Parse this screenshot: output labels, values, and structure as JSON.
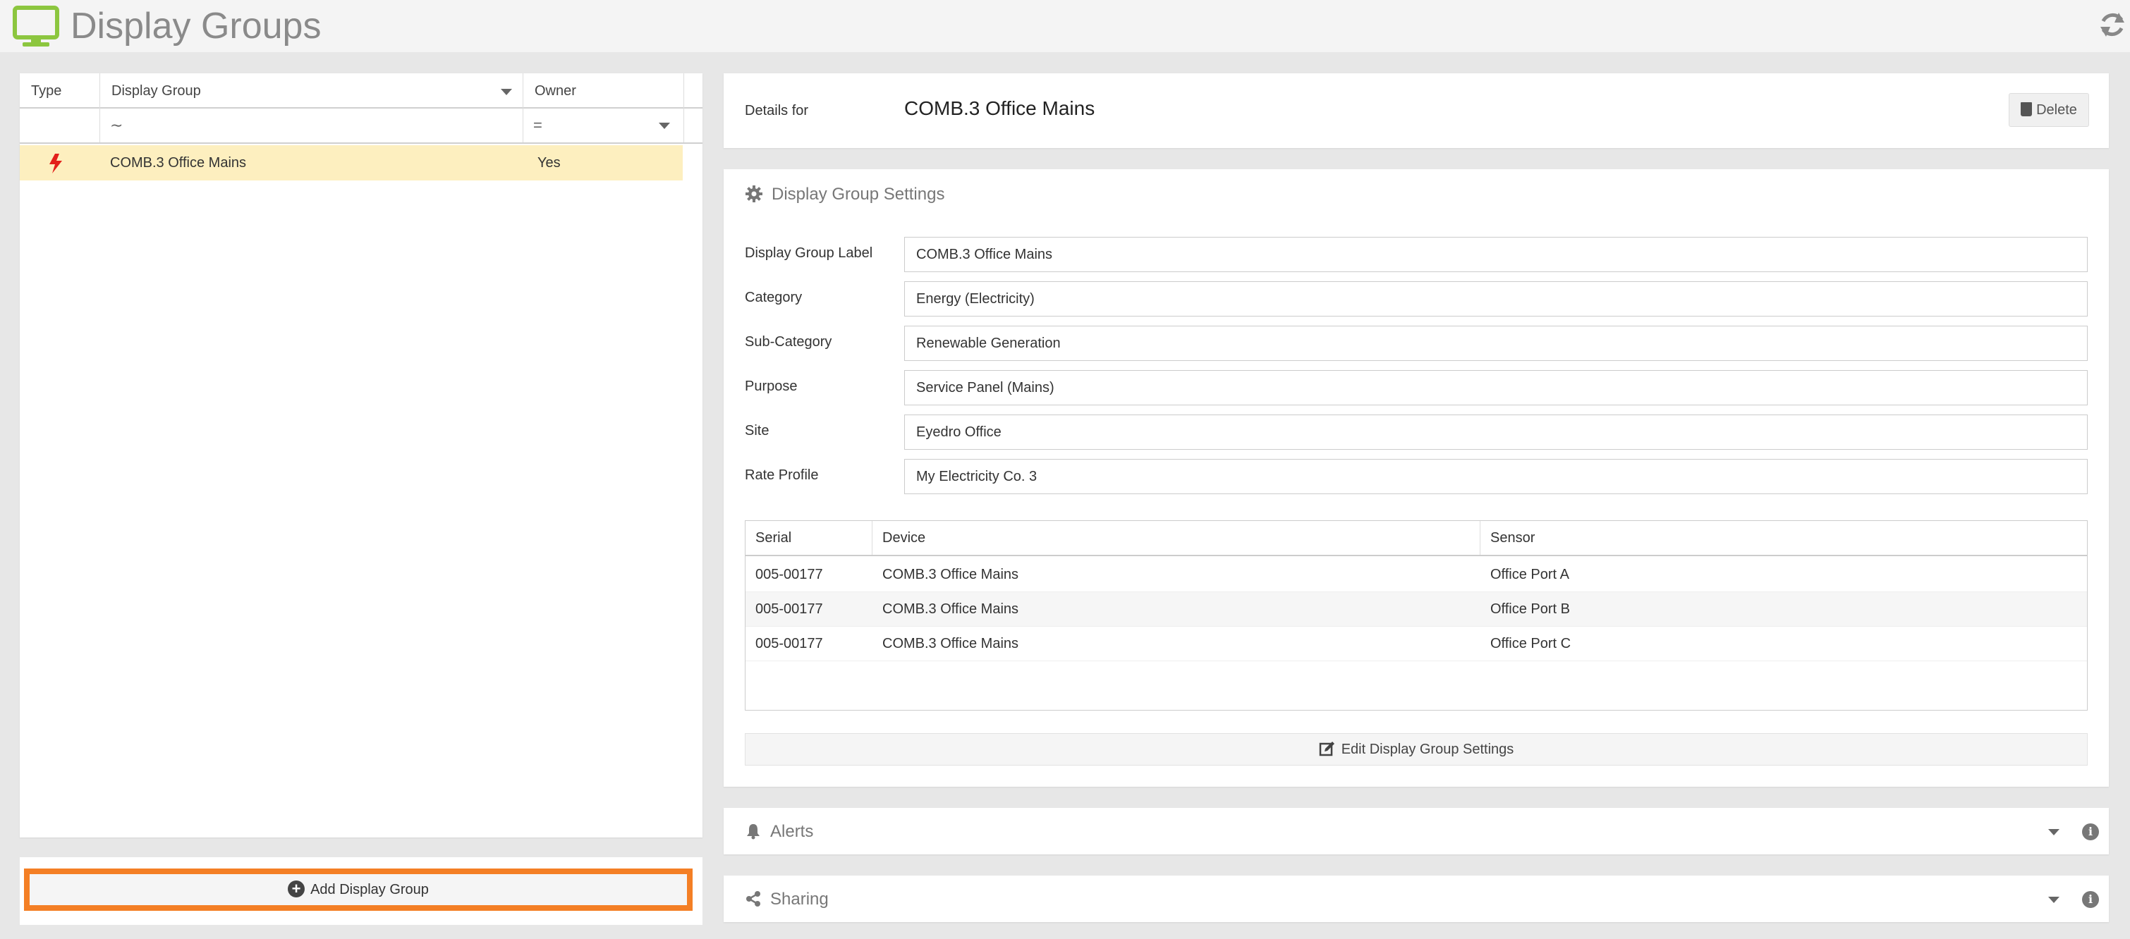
{
  "header": {
    "title": "Display Groups"
  },
  "grid": {
    "columns": {
      "type": "Type",
      "display_group": "Display Group",
      "owner": "Owner"
    },
    "filters": {
      "display_group": "∼",
      "owner": "="
    },
    "rows": [
      {
        "display_group": "COMB.3 Office Mains",
        "owner": "Yes"
      }
    ]
  },
  "add_button": {
    "label": "Add Display Group"
  },
  "details": {
    "label": "Details for",
    "name": "COMB.3 Office Mains",
    "delete_label": "Delete"
  },
  "settings": {
    "title": "Display Group Settings",
    "fields": [
      {
        "label": "Display Group Label",
        "value": "COMB.3 Office Mains"
      },
      {
        "label": "Category",
        "value": "Energy (Electricity)"
      },
      {
        "label": "Sub-Category",
        "value": "Renewable Generation"
      },
      {
        "label": "Purpose",
        "value": "Service Panel (Mains)"
      },
      {
        "label": "Site",
        "value": "Eyedro Office"
      },
      {
        "label": "Rate Profile",
        "value": "My Electricity Co. 3"
      }
    ],
    "devices": {
      "columns": {
        "serial": "Serial",
        "device": "Device",
        "sensor": "Sensor"
      },
      "rows": [
        {
          "serial": "005-00177",
          "device": "COMB.3 Office Mains",
          "sensor": "Office Port A"
        },
        {
          "serial": "005-00177",
          "device": "COMB.3 Office Mains",
          "sensor": "Office Port B"
        },
        {
          "serial": "005-00177",
          "device": "COMB.3 Office Mains",
          "sensor": "Office Port C"
        }
      ]
    },
    "edit_label": "Edit Display Group Settings"
  },
  "alerts": {
    "title": "Alerts"
  },
  "sharing": {
    "title": "Sharing"
  },
  "icons": {
    "app": "monitor-icon",
    "refresh": "refresh-icon",
    "type": "lightning-bolt-icon",
    "settings": "gear-icon",
    "alerts": "bell-icon",
    "sharing": "share-icon",
    "delete": "trash-icon",
    "edit": "edit-icon",
    "add": "plus-circle-icon",
    "info": "info-icon"
  },
  "colors": {
    "accent": "#8cc63f",
    "highlight": "#f47f25",
    "selected_row": "#fdefbf",
    "bolt": "#e3201b"
  }
}
